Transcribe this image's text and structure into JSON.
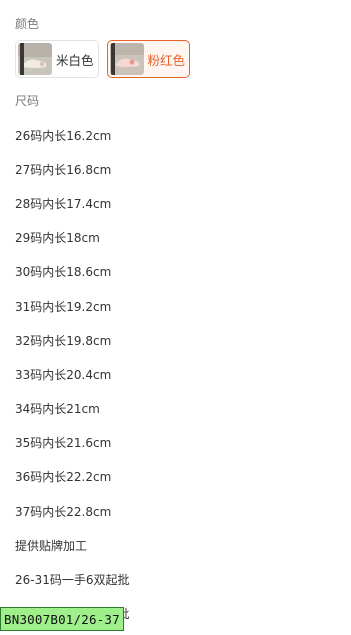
{
  "color_section": {
    "label": "颜色",
    "options": [
      {
        "label": "米白色",
        "selected": false,
        "thumb_icon": "shoe-thumbnail-icon"
      },
      {
        "label": "粉红色",
        "selected": true,
        "thumb_icon": "shoe-thumbnail-icon"
      }
    ],
    "selected_color": "#e8622e"
  },
  "size_section": {
    "label": "尺码",
    "items": [
      "26码内长16.2cm",
      "27码内长16.8cm",
      "28码内长17.4cm",
      "29码内长18cm",
      "30码内长18.6cm",
      "31码内长19.2cm",
      "32码内长19.8cm",
      "33码内长20.4cm",
      "34码内长21cm",
      "35码内长21.6cm",
      "36码内长22.2cm",
      "37码内长22.8cm",
      "提供贴牌加工",
      "26-31码一手6双起批",
      "32-37码一手6双起批"
    ]
  },
  "sku_tag": {
    "text": "BN3007B01/26-37",
    "color": "#9ff08a"
  }
}
